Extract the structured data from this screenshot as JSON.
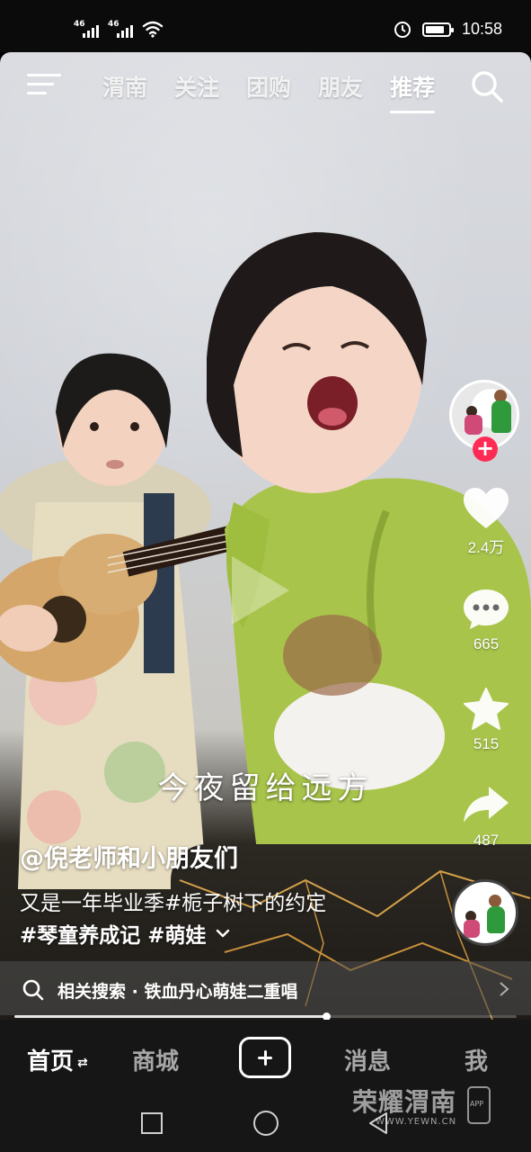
{
  "status_bar": {
    "sim1_label": "46",
    "sim2_label": "46",
    "time": "10:58",
    "battery_level": 0.85
  },
  "top_nav": {
    "tabs": [
      {
        "label": "渭南"
      },
      {
        "label": "关注"
      },
      {
        "label": "团购"
      },
      {
        "label": "朋友"
      },
      {
        "label": "推荐"
      }
    ],
    "active_tab": "推荐"
  },
  "video": {
    "caption_overlay": "今夜留给远方",
    "author": "@倪老师和小朋友们",
    "description_line1": "又是一年毕业季#栀子树下的约定",
    "description_line2": "#琴童养成记 #萌娃",
    "progress": 0.62
  },
  "rail": {
    "likes": "2.4万",
    "comments": "665",
    "favorites": "515",
    "shares": "487"
  },
  "related_search": {
    "text": "相关搜索 · 铁血丹心萌娃二重唱"
  },
  "tabbar": {
    "home": "首页",
    "mall": "商城",
    "messages": "消息",
    "me": "我"
  },
  "watermark": {
    "title": "荣耀渭南",
    "url": "WWW.YEWN.CN",
    "app_label": "APP"
  },
  "colors": {
    "follow_red": "#fe2c55",
    "tabbar_bg": "#161616"
  }
}
